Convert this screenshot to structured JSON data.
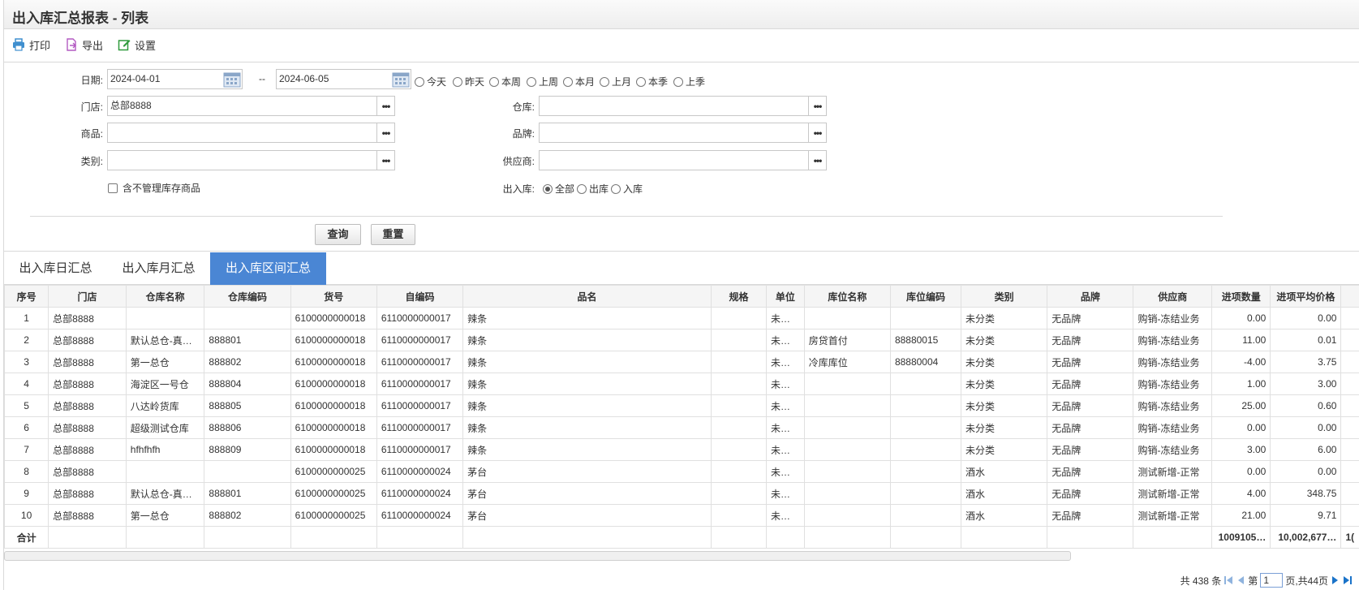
{
  "window": {
    "title": "出入库汇总报表 - 列表"
  },
  "toolbar": {
    "print": "打印",
    "export": "导出",
    "settings": "设置"
  },
  "filters": {
    "date_label": "日期:",
    "date_from": "2024-04-01",
    "date_sep": "--",
    "date_to": "2024-06-05",
    "quick_ranges": [
      "今天",
      "昨天",
      "本周",
      "上周",
      "本月",
      "上月",
      "本季",
      "上季"
    ],
    "store_label": "门店:",
    "store_value": "总部8888",
    "warehouse_label": "仓库:",
    "warehouse_value": "",
    "product_label": "商品:",
    "product_value": "",
    "brand_label": "品牌:",
    "brand_value": "",
    "category_label": "类别:",
    "category_value": "",
    "supplier_label": "供应商:",
    "supplier_value": "",
    "include_unmanaged_label": "含不管理库存商品",
    "direction_label": "出入库:",
    "direction_options": [
      "全部",
      "出库",
      "入库"
    ],
    "direction_selected": "全部",
    "more_glyph": "•••"
  },
  "actions": {
    "query": "查询",
    "reset": "重置"
  },
  "tabs": [
    {
      "label": "出入库日汇总",
      "active": false
    },
    {
      "label": "出入库月汇总",
      "active": false
    },
    {
      "label": "出入库区间汇总",
      "active": true
    }
  ],
  "table": {
    "columns": [
      "序号",
      "门店",
      "仓库名称",
      "仓库编码",
      "货号",
      "自编码",
      "品名",
      "规格",
      "单位",
      "库位名称",
      "库位编码",
      "类别",
      "品牌",
      "供应商",
      "进项数量",
      "进项平均价格"
    ],
    "rows": [
      [
        "1",
        "总部8888",
        "",
        "",
        "6100000000018",
        "6110000000017",
        "辣条",
        "",
        "未指定",
        "",
        "",
        "未分类",
        "无品牌",
        "购销-冻结业务",
        "0.00",
        "0.00"
      ],
      [
        "2",
        "总部8888",
        "默认总仓-真默…",
        "888801",
        "6100000000018",
        "6110000000017",
        "辣条",
        "",
        "未指定",
        "房贷首付",
        "88880015",
        "未分类",
        "无品牌",
        "购销-冻结业务",
        "11.00",
        "0.01"
      ],
      [
        "3",
        "总部8888",
        "第一总仓",
        "888802",
        "6100000000018",
        "6110000000017",
        "辣条",
        "",
        "未指定",
        "冷库库位",
        "88880004",
        "未分类",
        "无品牌",
        "购销-冻结业务",
        "-4.00",
        "3.75"
      ],
      [
        "4",
        "总部8888",
        "海淀区一号仓",
        "888804",
        "6100000000018",
        "6110000000017",
        "辣条",
        "",
        "未指定",
        "",
        "",
        "未分类",
        "无品牌",
        "购销-冻结业务",
        "1.00",
        "3.00"
      ],
      [
        "5",
        "总部8888",
        "八达岭货库",
        "888805",
        "6100000000018",
        "6110000000017",
        "辣条",
        "",
        "未指定",
        "",
        "",
        "未分类",
        "无品牌",
        "购销-冻结业务",
        "25.00",
        "0.60"
      ],
      [
        "6",
        "总部8888",
        "超级测试仓库",
        "888806",
        "6100000000018",
        "6110000000017",
        "辣条",
        "",
        "未指定",
        "",
        "",
        "未分类",
        "无品牌",
        "购销-冻结业务",
        "0.00",
        "0.00"
      ],
      [
        "7",
        "总部8888",
        "hfhfhfh",
        "888809",
        "6100000000018",
        "6110000000017",
        "辣条",
        "",
        "未指定",
        "",
        "",
        "未分类",
        "无品牌",
        "购销-冻结业务",
        "3.00",
        "6.00"
      ],
      [
        "8",
        "总部8888",
        "",
        "",
        "6100000000025",
        "6110000000024",
        "茅台",
        "",
        "未指定",
        "",
        "",
        "酒水",
        "无品牌",
        "测试新增-正常",
        "0.00",
        "0.00"
      ],
      [
        "9",
        "总部8888",
        "默认总仓-真默…",
        "888801",
        "6100000000025",
        "6110000000024",
        "茅台",
        "",
        "未指定",
        "",
        "",
        "酒水",
        "无品牌",
        "测试新增-正常",
        "4.00",
        "348.75"
      ],
      [
        "10",
        "总部8888",
        "第一总仓",
        "888802",
        "6100000000025",
        "6110000000024",
        "茅台",
        "",
        "未指定",
        "",
        "",
        "酒水",
        "无品牌",
        "测试新增-正常",
        "21.00",
        "9.71"
      ]
    ],
    "summary": {
      "label": "合计",
      "qty": "1009105…",
      "avg": "10,002,677…",
      "overflow": "1("
    }
  },
  "pager": {
    "total_text": "共 438 条",
    "page_prefix": "第",
    "page_value": "1",
    "page_suffix": "页,共44页"
  },
  "colors": {
    "tab_active": "#4a86d4",
    "icon_print": "#3f8fcf",
    "icon_export": "#b35ac2",
    "icon_settings": "#2f9a3c"
  }
}
